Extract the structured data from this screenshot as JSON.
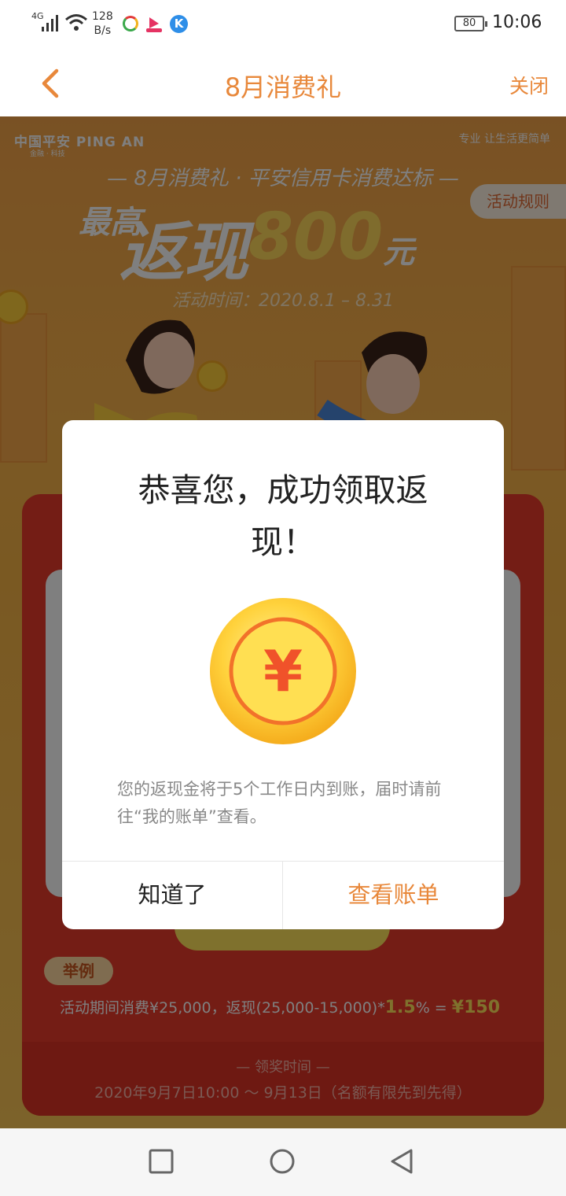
{
  "status_bar": {
    "network": "4G",
    "speed_value": "128",
    "speed_unit": "B/s",
    "battery": "80",
    "time": "10:06",
    "icons": [
      "signal-icon",
      "wifi-icon",
      "app-notification-icon",
      "video-app-icon",
      "k-app-icon",
      "battery-icon"
    ]
  },
  "nav": {
    "title": "8月消费礼",
    "close_label": "关闭",
    "back_icon": "chevron-left-icon"
  },
  "banner": {
    "brand": "中国平安 PING AN",
    "brand_sub": "金融 · 科技",
    "slogan": "专业 让生活更简单",
    "subheading": "— 8月消费礼 · 平安信用卡消费达标 —",
    "rules_button": "活动规则",
    "headline_prefix": "最高",
    "headline_main": "返现",
    "headline_amount": "800",
    "headline_unit": "元",
    "period": "活动时间：2020.8.1 – 8.31"
  },
  "example": {
    "badge": "举例",
    "text_prefix": "活动期间消费¥25,000，返现(25,000-15,000)*",
    "rate": "1.5",
    "text_mid": "% = ",
    "result": "¥150"
  },
  "award": {
    "title": "— 领奖时间 —",
    "time": "2020年9月7日10:00 ～ 9月13日（名额有限先到先得）"
  },
  "dialog": {
    "title": "恭喜您，成功领取返现！",
    "message": "您的返现金将于5个工作日内到账，届时请前往“我的账单”查看。",
    "coin_symbol": "¥",
    "ok_button": "知道了",
    "view_bill_button": "查看账单"
  },
  "colors": {
    "accent": "#e8883b",
    "banner_red": "#e83a2b",
    "gold": "#ffd85a"
  }
}
